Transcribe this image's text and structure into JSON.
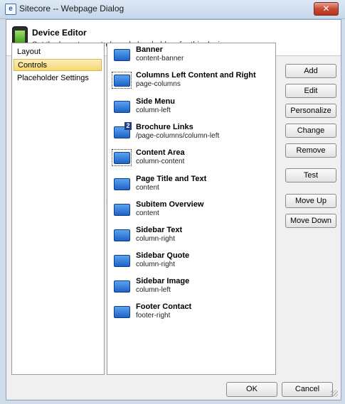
{
  "window": {
    "title": "Sitecore -- Webpage Dialog",
    "close_glyph": "✕",
    "app_icon_glyph": "e"
  },
  "header": {
    "title": "Device Editor",
    "subtitle": "Set the layouts, controls and placeholders for this device."
  },
  "nav": {
    "items": [
      {
        "label": "Layout",
        "selected": false
      },
      {
        "label": "Controls",
        "selected": true
      },
      {
        "label": "Placeholder Settings",
        "selected": false
      }
    ]
  },
  "controls": [
    {
      "name": "Banner",
      "placeholder": "content-banner",
      "focused": false
    },
    {
      "name": "Columns Left Content and Right",
      "placeholder": "page-columns",
      "focused": true
    },
    {
      "name": "Side Menu",
      "placeholder": "column-left",
      "focused": false
    },
    {
      "name": "Brochure Links",
      "placeholder": "/page-columns/column-left",
      "focused": false,
      "badge": "2"
    },
    {
      "name": "Content Area",
      "placeholder": "column-content",
      "focused": true
    },
    {
      "name": "Page Title and Text",
      "placeholder": "content",
      "focused": false
    },
    {
      "name": "Subitem Overview",
      "placeholder": "content",
      "focused": false
    },
    {
      "name": "Sidebar Text",
      "placeholder": "column-right",
      "focused": false
    },
    {
      "name": "Sidebar Quote",
      "placeholder": "column-right",
      "focused": false
    },
    {
      "name": "Sidebar Image",
      "placeholder": "column-left",
      "focused": false
    },
    {
      "name": "Footer Contact",
      "placeholder": "footer-right",
      "focused": false
    }
  ],
  "buttons": {
    "add": "Add",
    "edit": "Edit",
    "personalize": "Personalize",
    "change": "Change",
    "remove": "Remove",
    "test": "Test",
    "move_up": "Move Up",
    "move_down": "Move Down"
  },
  "footer": {
    "ok": "OK",
    "cancel": "Cancel"
  },
  "colors": {
    "selection": "#f6d873",
    "accent": "#1f63c8",
    "close": "#c74a33"
  }
}
